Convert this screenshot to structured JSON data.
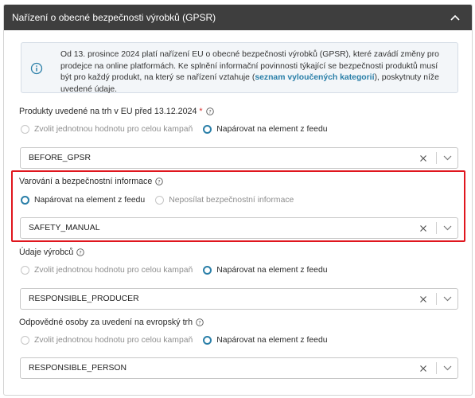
{
  "panel": {
    "title": "Nařízení o obecné bezpečnosti výrobků (GPSR)",
    "collapse_icon": "chevron-up-icon"
  },
  "info": {
    "icon": "info-icon",
    "text_part1": "Od 13. prosince 2024 platí nařízení EU o obecné bezpečnosti výrobků (GPSR), které zavádí změny pro prodejce na online platformách. Ke splnění informační povinnosti týkající se bezpečnosti produktů musí být pro každý produkt, na který se nařízení vztahuje (",
    "link_text": "seznam vyloučených kategorií",
    "text_part2": "), poskytnuty níže uvedené údaje."
  },
  "fields": [
    {
      "label": "Produkty uvedené na trh v EU před 13.12.2024",
      "required_mark": "*",
      "options": [
        {
          "label": "Zvolit jednotnou hodnotu pro celou kampaň",
          "selected": false
        },
        {
          "label": "Napárovat na element z feedu",
          "selected": true
        }
      ],
      "value": "BEFORE_GPSR"
    },
    {
      "label": "Varování a bezpečnostní informace",
      "options": [
        {
          "label": "Napárovat na element z feedu",
          "selected": true
        },
        {
          "label": "Neposílat bezpečnostní informace",
          "selected": false
        }
      ],
      "value": "SAFETY_MANUAL"
    },
    {
      "label": "Údaje výrobců",
      "options": [
        {
          "label": "Zvolit jednotnou hodnotu pro celou kampaň",
          "selected": false
        },
        {
          "label": "Napárovat na element z feedu",
          "selected": true
        }
      ],
      "value": "RESPONSIBLE_PRODUCER"
    },
    {
      "label": "Odpovědné osoby za uvedení na evropský trh",
      "options": [
        {
          "label": "Zvolit jednotnou hodnotu pro celou kampaň",
          "selected": false
        },
        {
          "label": "Napárovat na element z feedu",
          "selected": true
        }
      ],
      "value": "RESPONSIBLE_PERSON"
    }
  ],
  "colors": {
    "header_bg": "#3e3e3e",
    "accent": "#2a7fa8",
    "highlight": "#e0161e",
    "required": "#d9302f"
  }
}
